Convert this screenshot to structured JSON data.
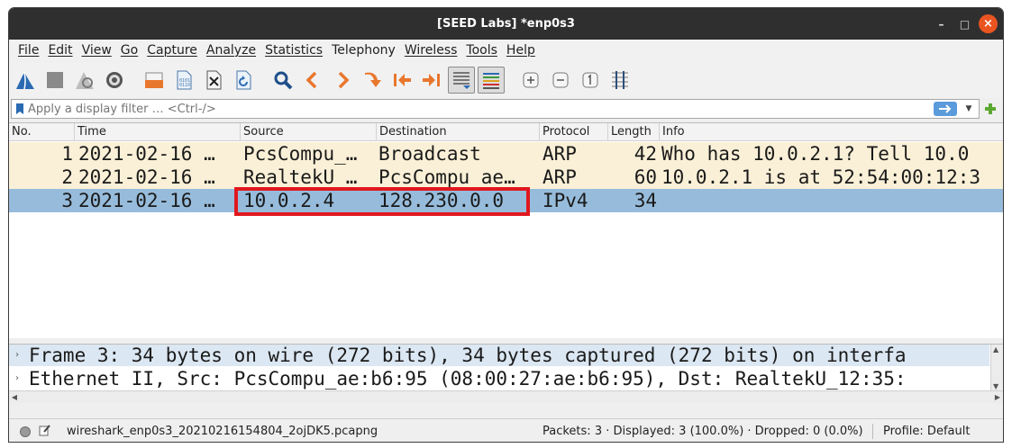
{
  "window": {
    "title": "[SEED Labs] *enp0s3"
  },
  "window_controls": {
    "minimize": "–",
    "maximize": "□",
    "close": "×"
  },
  "menu": [
    "File",
    "Edit",
    "View",
    "Go",
    "Capture",
    "Analyze",
    "Statistics",
    "Telephony",
    "Wireless",
    "Tools",
    "Help"
  ],
  "toolbar": [
    "shark-fin-icon",
    "stop-square-icon",
    "restart-fin-icon",
    "options-gear-icon",
    "open-folder-icon",
    "save-file-icon",
    "close-file-icon",
    "reload-icon",
    "find-magnifier-icon",
    "go-back-icon",
    "go-forward-icon",
    "go-to-packet-icon",
    "go-first-icon",
    "go-last-icon",
    "autoscroll-icon",
    "colorize-icon",
    "zoom-in-icon",
    "zoom-out-icon",
    "normal-size-icon",
    "resize-columns-icon"
  ],
  "filter": {
    "placeholder": "Apply a display filter … <Ctrl-/>"
  },
  "columns": [
    "No.",
    "Time",
    "Source",
    "Destination",
    "Protocol",
    "Length",
    "Info"
  ],
  "packets": [
    {
      "no": "1",
      "time": "2021-02-16 …",
      "source": "PcsCompu_…",
      "destination": "Broadcast",
      "protocol": "ARP",
      "length": "42",
      "info": "Who has 10.0.2.1? Tell 10.0"
    },
    {
      "no": "2",
      "time": "2021-02-16 …",
      "source": "RealtekU_…",
      "destination": "PcsCompu_ae…",
      "protocol": "ARP",
      "length": "60",
      "info": "10.0.2.1 is at 52:54:00:12:3"
    },
    {
      "no": "3",
      "time": "2021-02-16 …",
      "source": "10.0.2.4",
      "destination": "128.230.0.0",
      "protocol": "IPv4",
      "length": "34",
      "info": ""
    }
  ],
  "details": [
    "Frame 3: 34 bytes on wire (272 bits), 34 bytes captured (272 bits) on interfa",
    "Ethernet II, Src: PcsCompu_ae:b6:95 (08:00:27:ae:b6:95), Dst: RealtekU_12:35:"
  ],
  "status": {
    "file": "wireshark_enp0s3_20210216154804_2ojDK5.pcapng",
    "stats": "Packets: 3 · Displayed: 3 (100.0%) · Dropped: 0 (0.0%)",
    "profile": "Profile: Default"
  },
  "colors": {
    "arp_row": "#faf0d7",
    "selected_row": "#97bcdb",
    "highlight": "#e0181e",
    "titlebar": "#2f2f2f",
    "close": "#e95420"
  }
}
